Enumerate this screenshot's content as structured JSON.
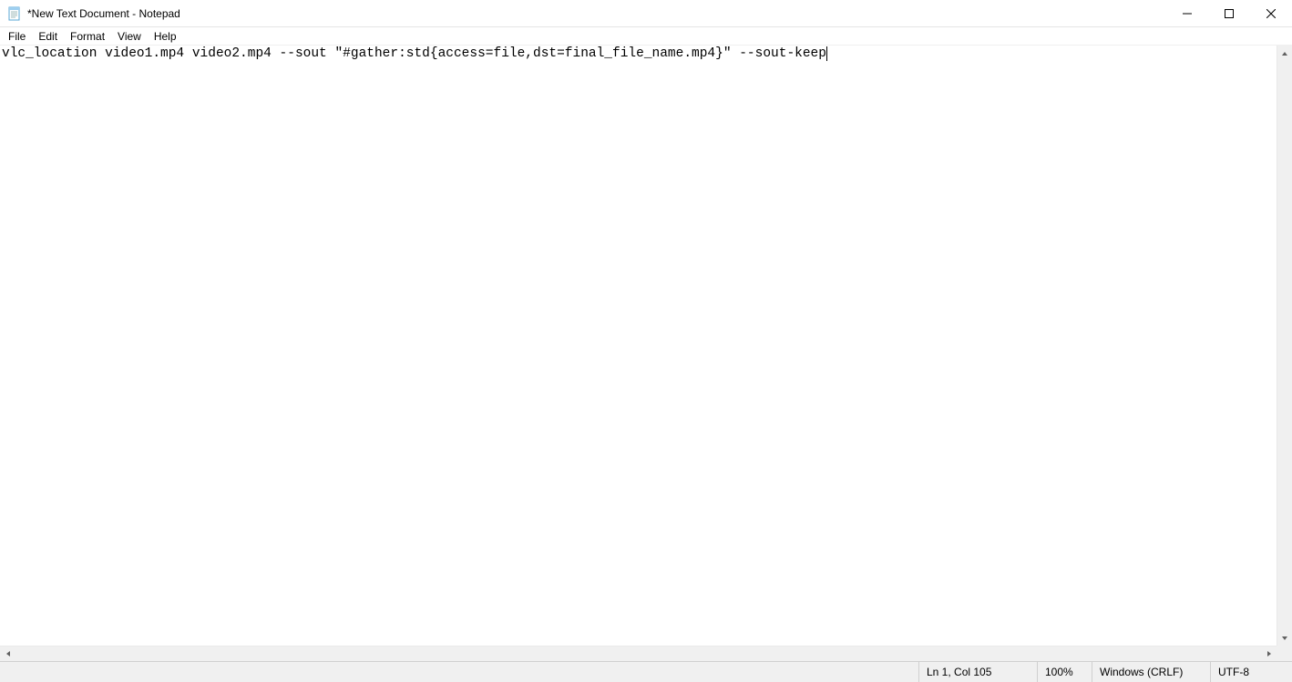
{
  "window": {
    "title": "*New Text Document - Notepad"
  },
  "menu": {
    "items": [
      "File",
      "Edit",
      "Format",
      "View",
      "Help"
    ]
  },
  "editor": {
    "content": "vlc_location video1.mp4 video2.mp4 --sout \"#gather:std{access=file,dst=final_file_name.mp4}\" --sout-keep"
  },
  "status": {
    "position": "Ln 1, Col 105",
    "zoom": "100%",
    "line_ending": "Windows (CRLF)",
    "encoding": "UTF-8"
  }
}
